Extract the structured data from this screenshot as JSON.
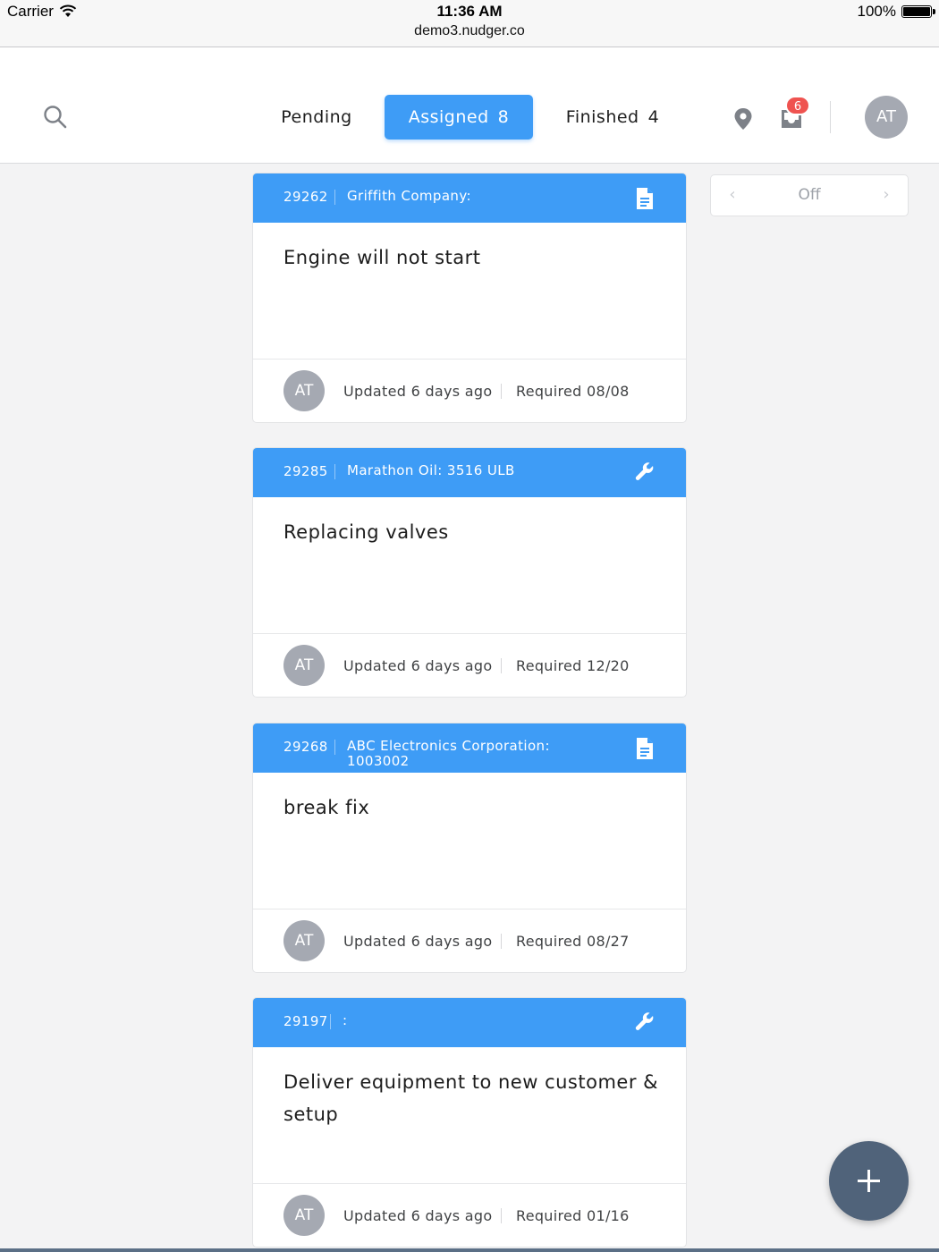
{
  "status_bar": {
    "carrier": "Carrier",
    "time": "11:36 AM",
    "url": "demo3.nudger.co",
    "battery": "100%"
  },
  "header": {
    "tabs": [
      {
        "label": "Pending",
        "count": ""
      },
      {
        "label": "Assigned",
        "count": "8"
      },
      {
        "label": "Finished",
        "count": "4"
      }
    ],
    "active_tab": "Assigned",
    "inbox_badge": "6",
    "avatar_initials": "AT"
  },
  "filter": {
    "value": "Off",
    "prev": "‹",
    "next": "›"
  },
  "cards": [
    {
      "id": "29262",
      "company": "Griffith Company:",
      "icon": "document-icon",
      "title": "Engine will not start",
      "avatar": "AT",
      "updated": "Updated 6 days ago",
      "required": "Required 08/08"
    },
    {
      "id": "29285",
      "company": "Marathon Oil: 3516 ULB",
      "icon": "wrench-icon",
      "title": "Replacing valves",
      "avatar": "AT",
      "updated": "Updated 6 days ago",
      "required": "Required 12/20"
    },
    {
      "id": "29268",
      "company": "ABC Electronics Corporation: 1003002",
      "icon": "document-icon",
      "title": "break fix",
      "avatar": "AT",
      "updated": "Updated 6 days ago",
      "required": "Required 08/27"
    },
    {
      "id": "29197",
      "company": ":",
      "icon": "wrench-icon",
      "title": "Deliver equipment to new customer & setup",
      "avatar": "AT",
      "updated": "Updated 6 days ago",
      "required": "Required 01/16"
    }
  ],
  "colors": {
    "accent": "#3e9cf6",
    "badge": "#ef5350",
    "avatar": "#a5a9b2",
    "fab": "#50637a"
  }
}
